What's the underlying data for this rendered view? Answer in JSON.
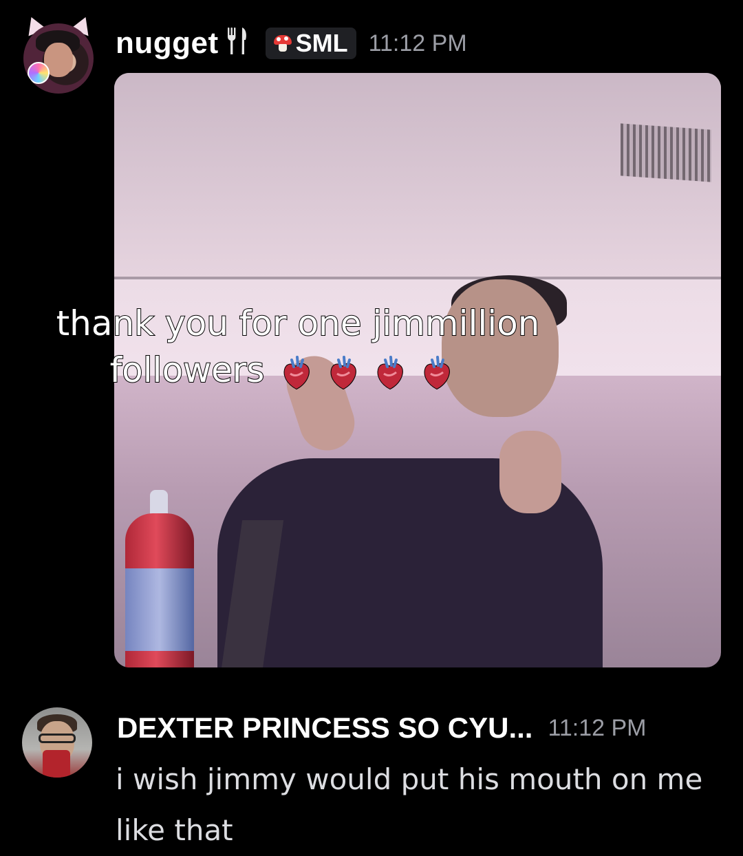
{
  "messages": [
    {
      "author": "nugget",
      "author_icon": "fork-and-knife-icon",
      "tag": {
        "icon": "mushroom-icon",
        "label": "SML"
      },
      "timestamp": "11:12 PM",
      "attachment": {
        "type": "video-still",
        "caption_line_1": "thank you for one jimmillion",
        "caption_line_2": "followers",
        "caption_emoji": [
          "anatomical-heart-icon",
          "anatomical-heart-icon",
          "anatomical-heart-icon",
          "anatomical-heart-icon"
        ]
      }
    },
    {
      "author": "DEXTER PRINCESS SO CYU...",
      "timestamp": "11:12 PM",
      "text": "i wish jimmy would put his mouth on me like that"
    }
  ],
  "colors": {
    "background": "#000000",
    "username": "#ffffff",
    "timestamp": "#9c9ea6",
    "message_text": "#dcdde1",
    "tag_background": "#1f2024"
  }
}
